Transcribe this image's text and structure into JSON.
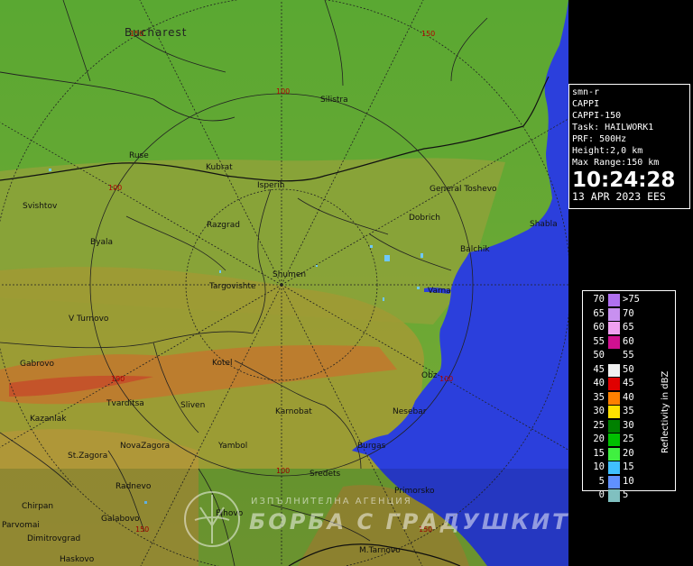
{
  "colors": {
    "sea": "#2b3fdc",
    "land_low": "#5aa332",
    "land_mid": "#93a83a",
    "land_high": "#b89a30",
    "mountain": "#c0582a",
    "grid": "#222222",
    "range_label": "#b30000"
  },
  "info": {
    "lines": [
      "smn-r",
      "CAPPI",
      "CAPPI-150",
      "Task: HAILWORK1",
      "PRF: 500Hz",
      "Height:2,0 km",
      "Max Range:150 km"
    ],
    "time": "10:24:28",
    "date": "13 APR 2023 EES"
  },
  "legend": {
    "title": "Reflectivity in dBZ",
    "rows": [
      {
        "lo": "70",
        "hi": ">75",
        "color": "#b070f0"
      },
      {
        "lo": "65",
        "hi": "70",
        "color": "#c890f0"
      },
      {
        "lo": "60",
        "hi": "65",
        "color": "#f0a0f0"
      },
      {
        "lo": "55",
        "hi": "60",
        "color": "#d01090"
      },
      {
        "lo": "50",
        "hi": "55",
        "color": "#000000"
      },
      {
        "lo": "45",
        "hi": "50",
        "color": "#f0f0f0"
      },
      {
        "lo": "40",
        "hi": "45",
        "color": "#e00000"
      },
      {
        "lo": "35",
        "hi": "40",
        "color": "#ff8000"
      },
      {
        "lo": "30",
        "hi": "35",
        "color": "#ffe000"
      },
      {
        "lo": "25",
        "hi": "30",
        "color": "#008000"
      },
      {
        "lo": "20",
        "hi": "25",
        "color": "#00c000"
      },
      {
        "lo": "15",
        "hi": "20",
        "color": "#40f040"
      },
      {
        "lo": "10",
        "hi": "15",
        "color": "#40c0ff"
      },
      {
        "lo": "5",
        "hi": "10",
        "color": "#6090ff"
      },
      {
        "lo": "0",
        "hi": "5",
        "color": "#80c0c0"
      }
    ]
  },
  "map": {
    "cities": {
      "bucharest": "Bucharest",
      "silistra": "Silistra",
      "ruse": "Ruse",
      "kubrat": "Kubrat",
      "isperih": "Isperih",
      "general_toshevo": "General Toshevo",
      "svishtov": "Svishtov",
      "razgrad": "Razgrad",
      "dobrich": "Dobrich",
      "shabla": "Shabla",
      "byala": "Byala",
      "balchik": "Balchik",
      "shumen": "Shumen",
      "targovishte": "Targovishte",
      "varna": "Varna",
      "v_tarnovo": "V Turnovo",
      "gabrovo": "Gabrovo",
      "kotel": "Kotel",
      "obzor": "Obz",
      "tvarditsa": "Tvarditsa",
      "sliven": "Sliven",
      "kazanlak": "Kazanlak",
      "karnobat": "Karnobat",
      "nesebar": "Nesebar",
      "nova_zagora": "NovaZagora",
      "st_zagora": "St.Zagora",
      "yambol": "Yambol",
      "burgas": "Burgas",
      "sredets": "Sredets",
      "radnevo": "Radnevo",
      "primorsko": "Primorsko",
      "chirpan": "Chirpan",
      "elhovo": "Elhovo",
      "parvomai": "Parvomai",
      "galabovo": "Galabovo",
      "dimitrovgrad": "Dimitrovgrad",
      "haskovo": "Haskovo",
      "m_tarnovo": "M.Tarnovo"
    },
    "range_labels": {
      "r100": "100",
      "r150": "150"
    }
  },
  "watermark": {
    "small": "ИЗПЪЛНИТЕЛНА АГЕНЦИЯ",
    "big": "БОРБА С ГРАДУШКИТЕ"
  }
}
